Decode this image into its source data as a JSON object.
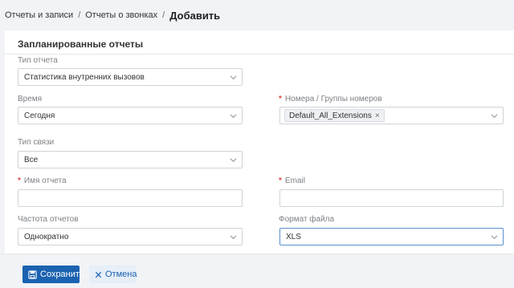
{
  "breadcrumb": {
    "item1": "Отчеты и записи",
    "item2": "Отчеты о звонках",
    "current": "Добавить",
    "separator": "/"
  },
  "form": {
    "title": "Запланированные отчеты",
    "report_type": {
      "label": "Тип отчета",
      "value": "Статистика внутренних вызовов"
    },
    "time": {
      "label": "Время",
      "value": "Сегодня"
    },
    "numbers": {
      "label": "Номера / Группы номеров",
      "required": "*",
      "tags": [
        "Default_All_Extensions"
      ],
      "tag_remove": "×"
    },
    "call_type": {
      "label": "Тип связи",
      "value": "Все"
    },
    "report_name": {
      "label": "Имя отчета",
      "required": "*",
      "value": ""
    },
    "email": {
      "label": "Email",
      "required": "*",
      "value": ""
    },
    "frequency": {
      "label": "Частота отчетов",
      "value": "Однократно"
    },
    "file_format": {
      "label": "Формат файла",
      "value": "XLS"
    }
  },
  "actions": {
    "save_label": "Сохранить",
    "cancel_label": "Отмена"
  },
  "colors": {
    "primary": "#1b62b0",
    "required": "#e04848",
    "background": "#f1f3f6"
  }
}
